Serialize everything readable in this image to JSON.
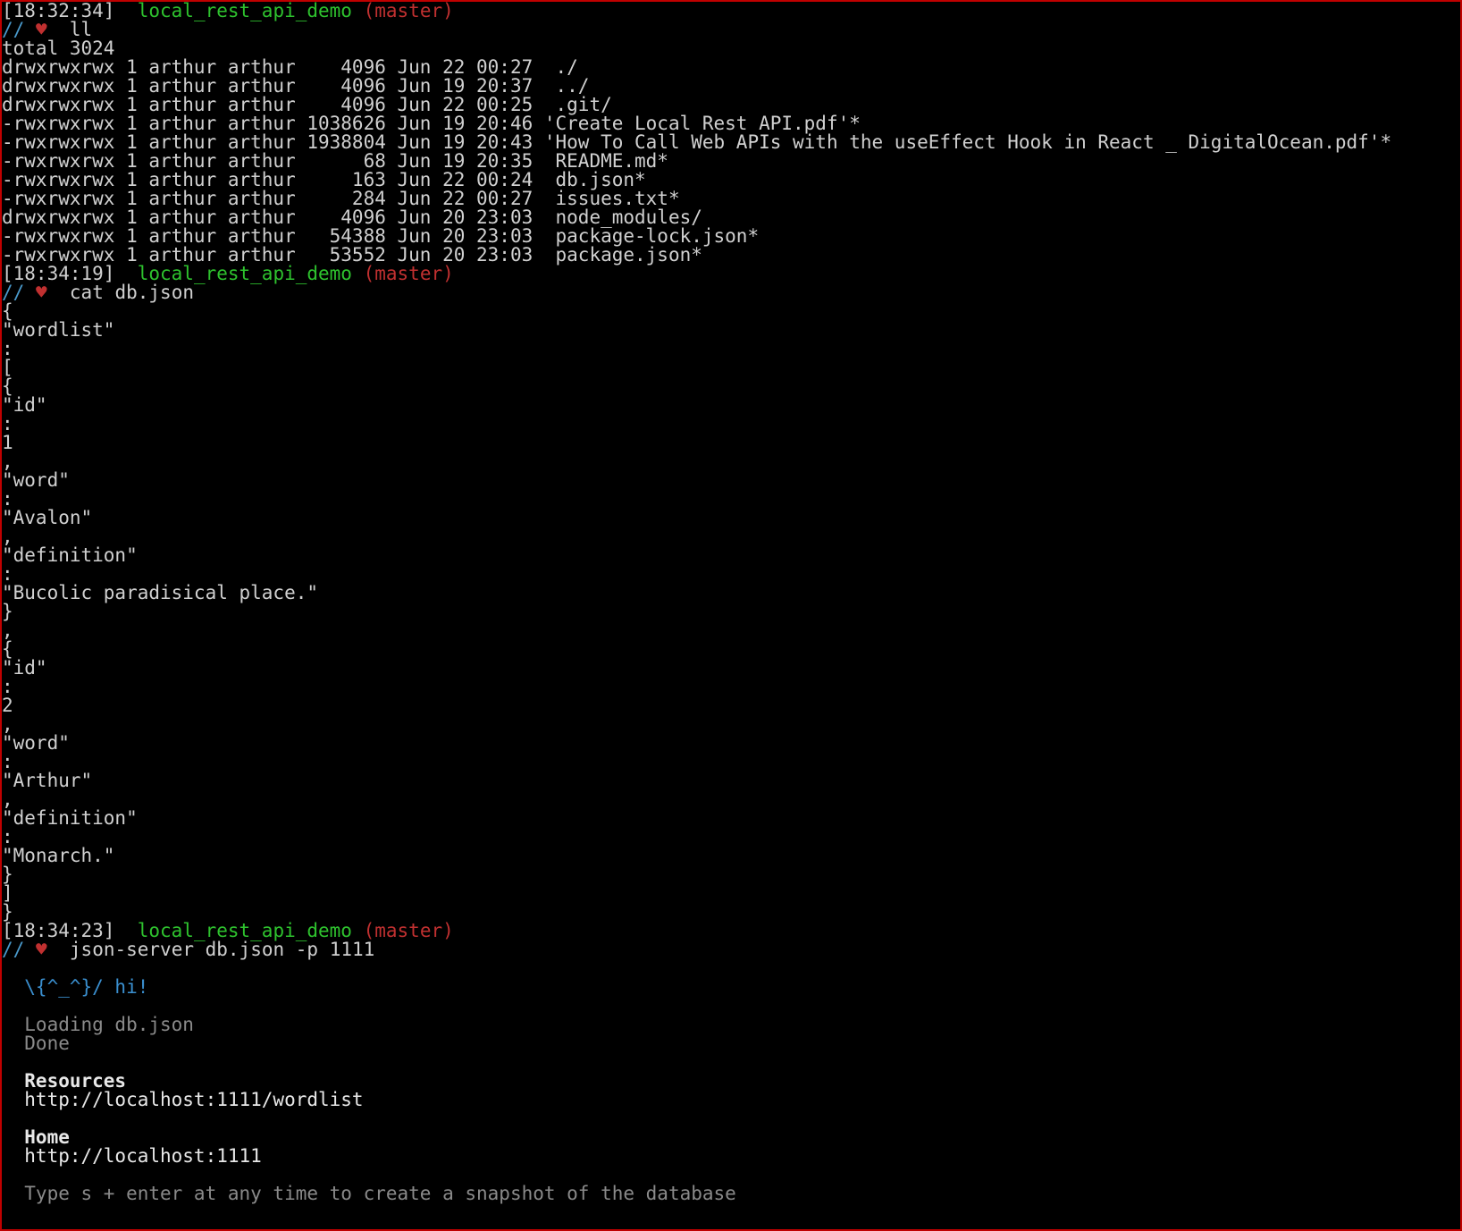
{
  "p1": {
    "ts": "[18:32:34]",
    "dir": "local_rest_api_demo",
    "branch": "(master)",
    "slash": "//",
    "heart": "♥",
    "cmd": "ll"
  },
  "ll": {
    "total": "total 3024",
    "rows": [
      "drwxrwxrwx 1 arthur arthur    4096 Jun 22 00:27  ./",
      "drwxrwxrwx 1 arthur arthur    4096 Jun 19 20:37  ../",
      "drwxrwxrwx 1 arthur arthur    4096 Jun 22 00:25  .git/",
      "-rwxrwxrwx 1 arthur arthur 1038626 Jun 19 20:46 'Create Local Rest API.pdf'*",
      "-rwxrwxrwx 1 arthur arthur 1938804 Jun 19 20:43 'How To Call Web APIs with the useEffect Hook in React _ DigitalOcean.pdf'*",
      "-rwxrwxrwx 1 arthur arthur      68 Jun 19 20:35  README.md*",
      "-rwxrwxrwx 1 arthur arthur     163 Jun 22 00:24  db.json*",
      "-rwxrwxrwx 1 arthur arthur     284 Jun 22 00:27  issues.txt*",
      "drwxrwxrwx 1 arthur arthur    4096 Jun 20 23:03  node_modules/",
      "-rwxrwxrwx 1 arthur arthur   54388 Jun 20 23:03  package-lock.json*",
      "-rwxrwxrwx 1 arthur arthur   53552 Jun 20 23:03  package.json*"
    ]
  },
  "p2": {
    "ts": "[18:34:19]",
    "dir": "local_rest_api_demo",
    "branch": "(master)",
    "slash": "//",
    "heart": "♥",
    "cmd": "cat db.json"
  },
  "cat": {
    "lines": [
      "{",
      "\"wordlist\"",
      ":",
      "[",
      "{",
      "\"id\"",
      ":",
      "1",
      ",",
      "\"word\"",
      ":",
      "\"Avalon\"",
      ",",
      "\"definition\"",
      ":",
      "\"Bucolic paradisical place.\"",
      "}",
      ",",
      "{",
      "\"id\"",
      ":",
      "2",
      ",",
      "\"word\"",
      ":",
      "\"Arthur\"",
      ",",
      "\"definition\"",
      ":",
      "\"Monarch.\"",
      "}",
      "]",
      "}"
    ]
  },
  "p3": {
    "ts": "[18:34:23]",
    "dir": "local_rest_api_demo",
    "branch": "(master)",
    "slash": "//",
    "heart": "♥",
    "cmd": "json-server db.json -p 1111"
  },
  "js": {
    "blank1": "",
    "logo": "  \\{^_^}/ hi!",
    "blank2": "",
    "loading": "  Loading db.json",
    "done": "  Done",
    "blank3": "",
    "res_hdr": "  Resources",
    "res_url": "  http://localhost:1111/wordlist",
    "blank4": "",
    "home_hdr": "  Home",
    "home_url": "  http://localhost:1111",
    "blank5": "",
    "tip": "  Type s + enter at any time to create a snapshot of the database"
  }
}
